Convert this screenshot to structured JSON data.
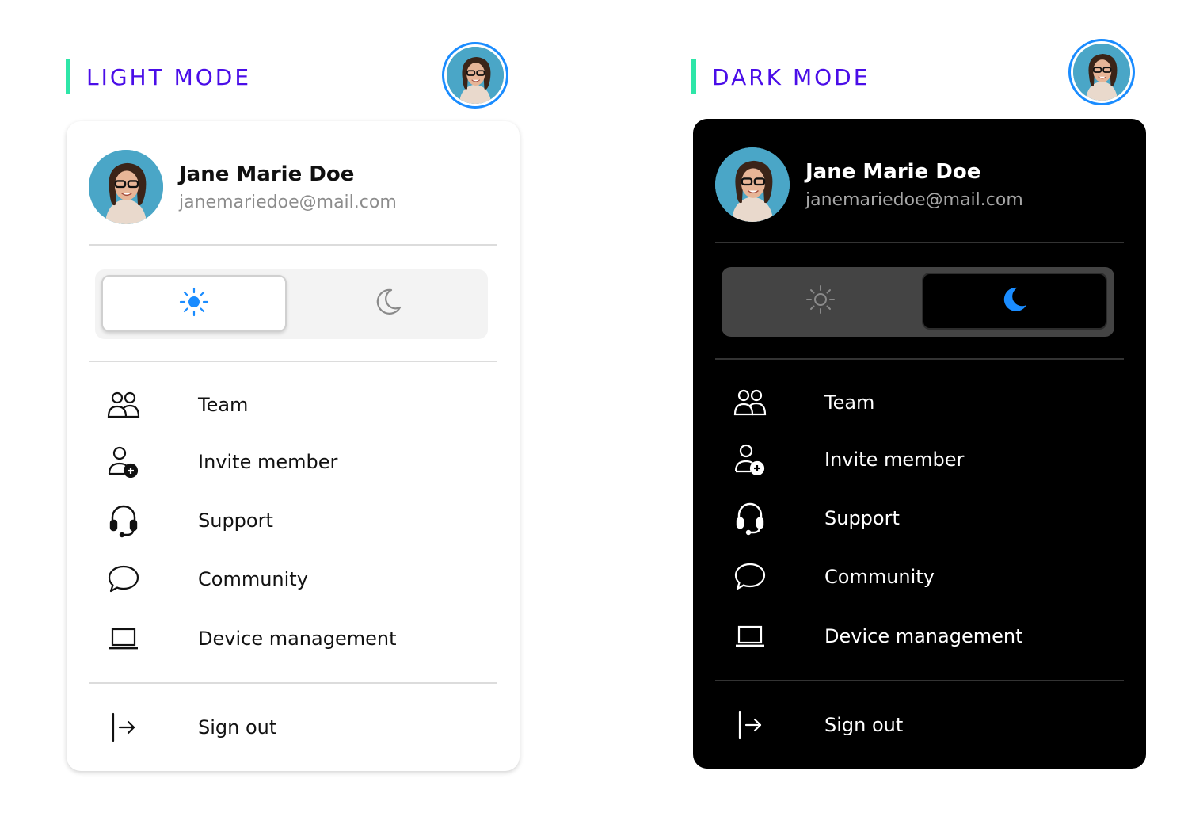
{
  "light": {
    "heading": "LIGHT MODE",
    "user": {
      "name": "Jane Marie Doe",
      "email": "janemariedoe@mail.com"
    },
    "theme_toggle": {
      "selected": "light"
    },
    "menu": [
      {
        "label": "Team",
        "icon": "team-icon"
      },
      {
        "label": "Invite member",
        "icon": "invite-member-icon"
      },
      {
        "label": "Support",
        "icon": "headset-icon"
      },
      {
        "label": "Community",
        "icon": "chat-bubble-icon"
      },
      {
        "label": "Device management",
        "icon": "laptop-icon"
      }
    ],
    "signout": "Sign out"
  },
  "dark": {
    "heading": "DARK MODE",
    "user": {
      "name": "Jane Marie Doe",
      "email": "janemariedoe@mail.com"
    },
    "theme_toggle": {
      "selected": "dark"
    },
    "menu": [
      {
        "label": "Team",
        "icon": "team-icon"
      },
      {
        "label": "Invite member",
        "icon": "invite-member-icon"
      },
      {
        "label": "Support",
        "icon": "headset-icon"
      },
      {
        "label": "Community",
        "icon": "chat-bubble-icon"
      },
      {
        "label": "Device management",
        "icon": "laptop-icon"
      }
    ],
    "signout": "Sign out"
  },
  "colors": {
    "heading_text": "#4a0de8",
    "heading_bar": "#2ee6a8",
    "accent_blue": "#1a8cff",
    "light_panel_bg": "#ffffff",
    "dark_panel_bg": "#000000"
  }
}
